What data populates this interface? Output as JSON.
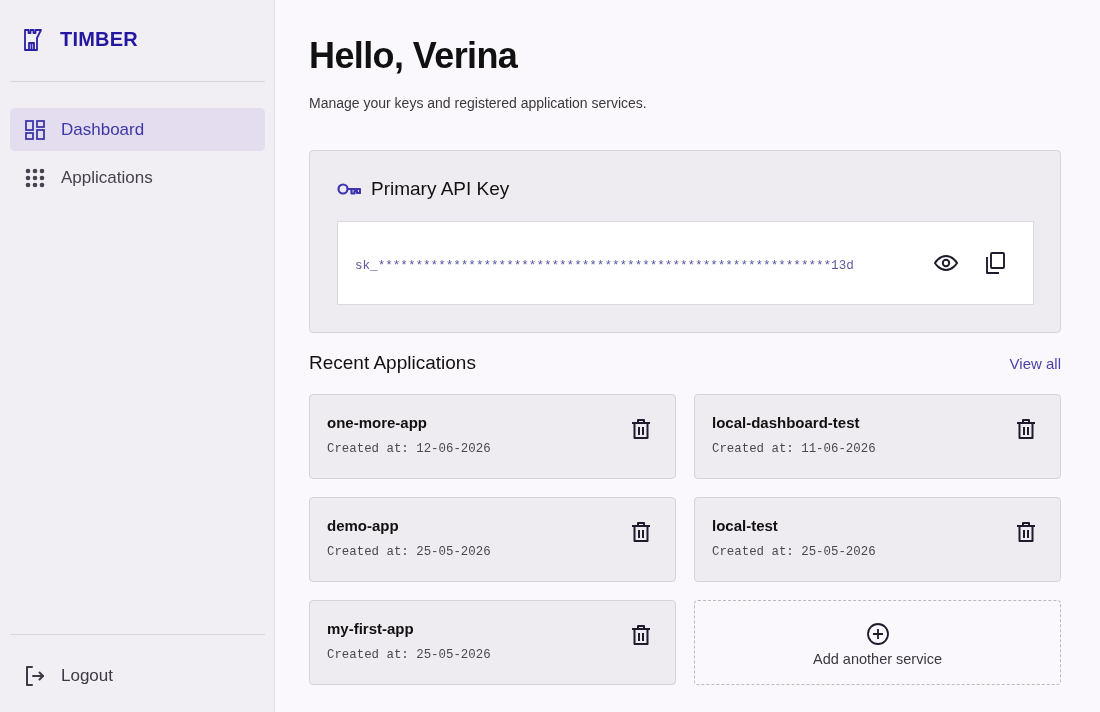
{
  "sidebar": {
    "brand": "TIMBER",
    "nav": [
      {
        "label": "Dashboard",
        "selected": true
      },
      {
        "label": "Applications",
        "selected": false
      }
    ],
    "logout": "Logout"
  },
  "header": {
    "title": "Hello, Verina",
    "subtitle": "Manage your keys and registered application services."
  },
  "api_key": {
    "title": "Primary API Key",
    "value": "sk_************************************************************13d"
  },
  "recent": {
    "title": "Recent Applications",
    "view_all": "View all",
    "apps": [
      {
        "name": "one-more-app",
        "created": "Created at: 12-06-2026"
      },
      {
        "name": "local-dashboard-test",
        "created": "Created at: 11-06-2026"
      },
      {
        "name": "demo-app",
        "created": "Created at: 25-05-2026"
      },
      {
        "name": "local-test",
        "created": "Created at: 25-05-2026"
      },
      {
        "name": "my-first-app",
        "created": "Created at: 25-05-2026"
      }
    ],
    "add_label": "Add another service"
  }
}
